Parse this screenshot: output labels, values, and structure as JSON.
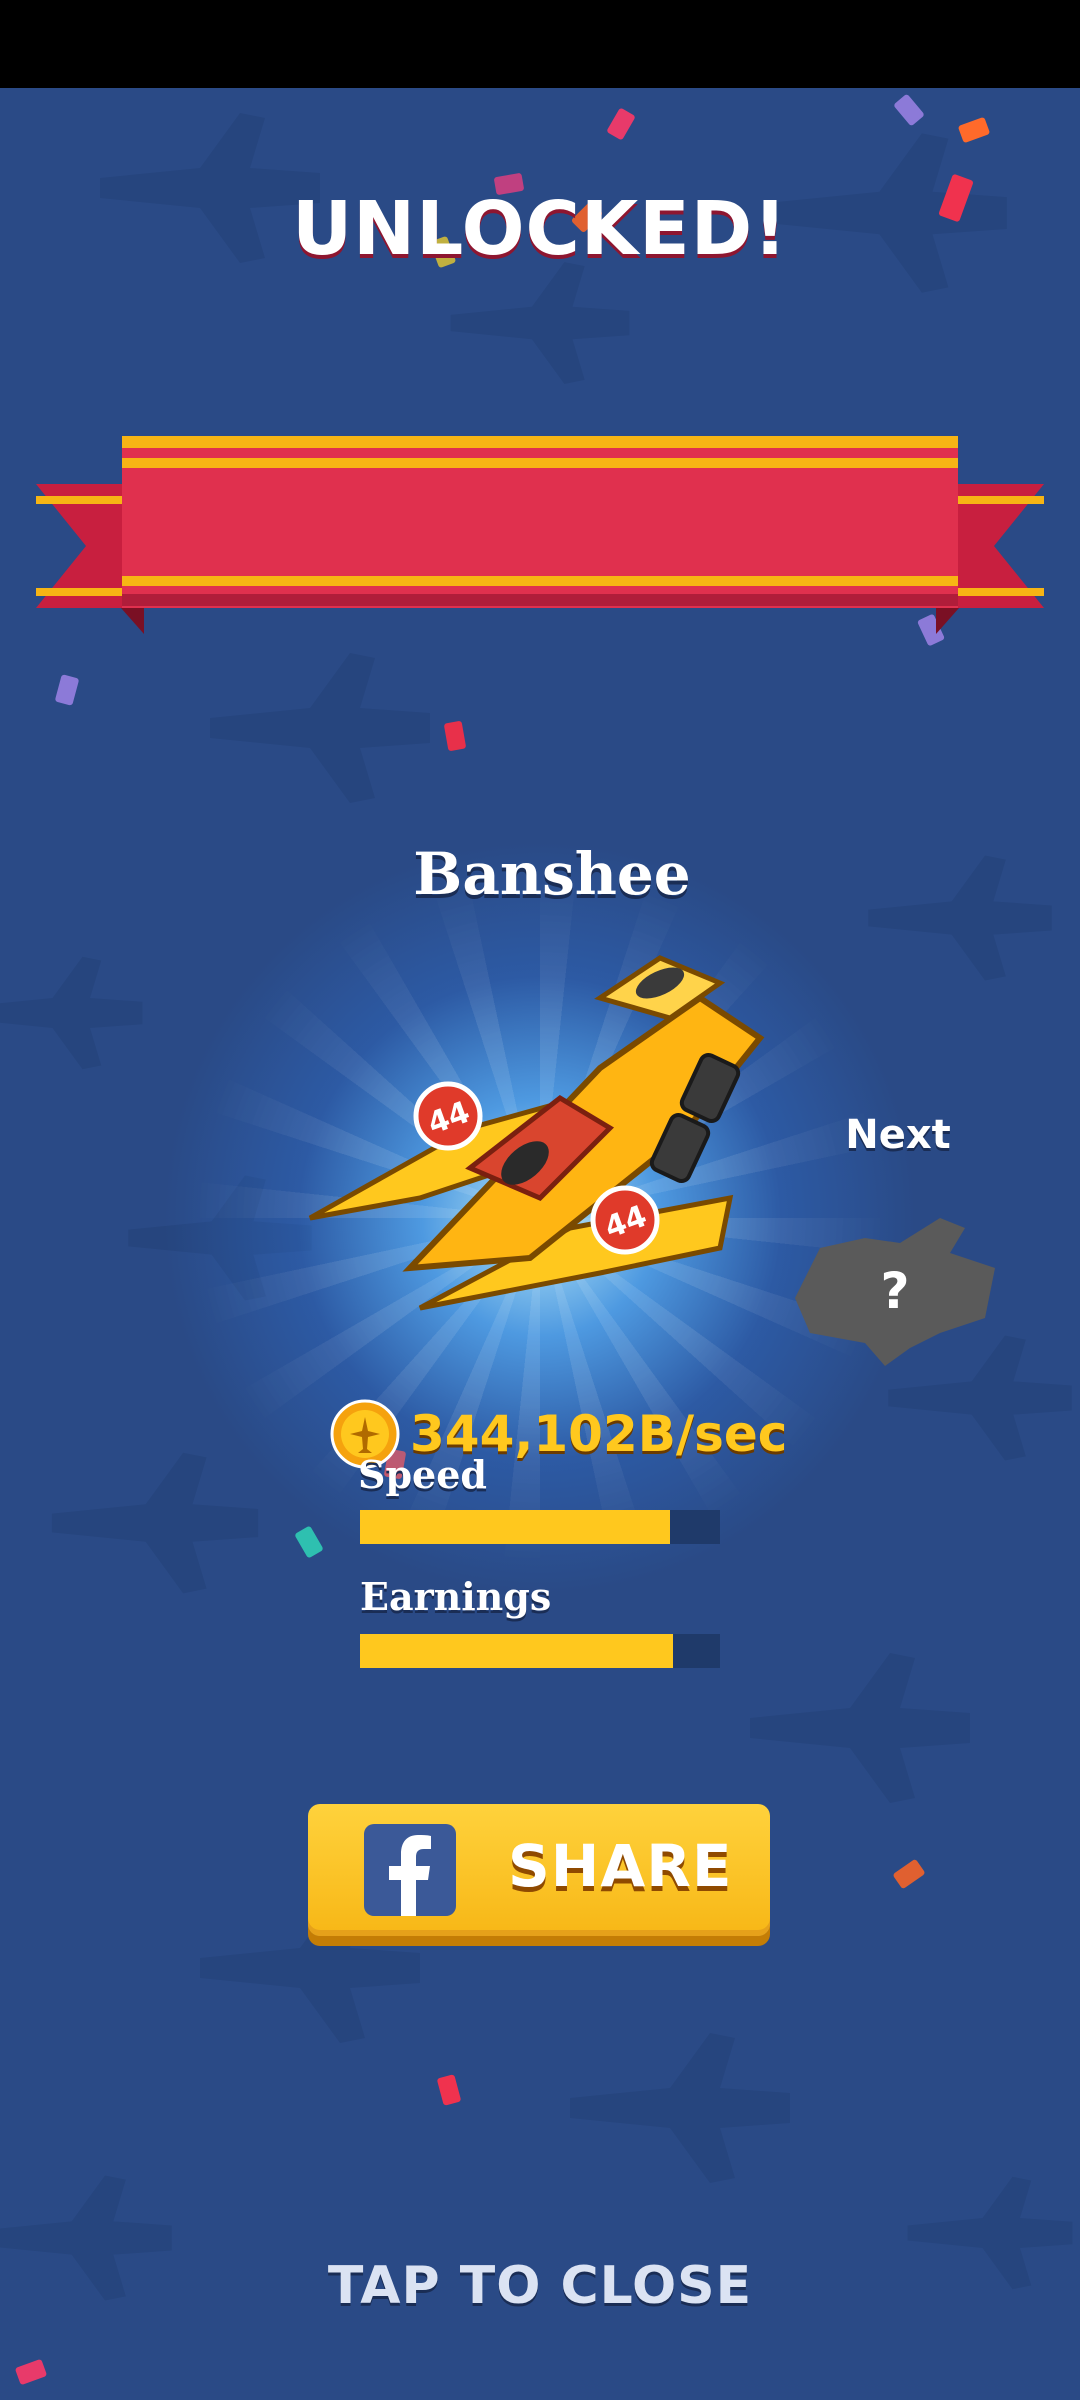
{
  "banner": {
    "title": "UNLOCKED!"
  },
  "plane": {
    "name": "Banshee",
    "badge_number": "44"
  },
  "next": {
    "label": "Next",
    "placeholder": "?"
  },
  "earnings": {
    "value": "344,102B/sec"
  },
  "stats": [
    {
      "label": "Speed",
      "level": 0.86
    },
    {
      "label": "Earnings",
      "level": 0.87
    }
  ],
  "share": {
    "label": "SHARE",
    "icon": "facebook-icon"
  },
  "close": {
    "label": "TAP TO CLOSE"
  },
  "colors": {
    "background": "#2a4a86",
    "ribbon_red": "#e0304e",
    "ribbon_gold": "#f7b514",
    "accent_yellow": "#ffc81e",
    "facebook_blue": "#3b5998"
  }
}
